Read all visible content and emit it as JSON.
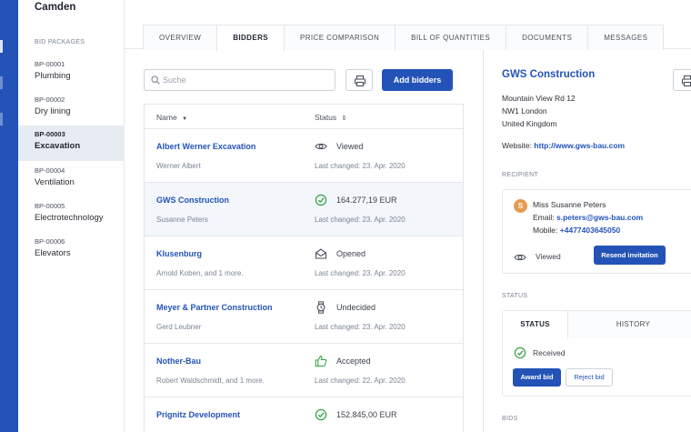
{
  "project": {
    "title": "Camden"
  },
  "sidebar": {
    "section_label": "BID PACKAGES",
    "packages": [
      {
        "code": "BP-00001",
        "name": "Plumbing"
      },
      {
        "code": "BP-00002",
        "name": "Dry lining"
      },
      {
        "code": "BP-00003",
        "name": "Excavation"
      },
      {
        "code": "BP-00004",
        "name": "Ventilation"
      },
      {
        "code": "BP-00005",
        "name": "Electrotechnology"
      },
      {
        "code": "BP-00006",
        "name": "Elevators"
      }
    ]
  },
  "tabs": [
    "OVERVIEW",
    "BIDDERS",
    "PRICE COMPARISON",
    "BILL OF QUANTITIES",
    "DOCUMENTS",
    "MESSAGES"
  ],
  "toolbar": {
    "search_placeholder": "Suche",
    "add_label": "Add bidders"
  },
  "table": {
    "col_name": "Name",
    "col_status": "Status",
    "rows": [
      {
        "name": "Albert Werner Excavation",
        "contact": "Werner Albert",
        "status": "Viewed",
        "status_icon": "eye-icon",
        "changed": "Last changed: 23. Apr. 2020"
      },
      {
        "name": "GWS Construction",
        "contact": "Susanne Peters",
        "status": "164.277,19 EUR",
        "status_icon": "check-circle-icon",
        "changed": "Last changed: 23. Apr. 2020"
      },
      {
        "name": "Klusenburg",
        "contact": "Arnold Koben, and 1 more.",
        "status": "Opened",
        "status_icon": "envelope-open-icon",
        "changed": "Last changed: 23. Apr. 2020"
      },
      {
        "name": "Meyer & Partner Construction",
        "contact": "Gerd Leubner",
        "status": "Undecided",
        "status_icon": "watch-icon",
        "changed": "Last changed: 23. Apr. 2020"
      },
      {
        "name": "Nother-Bau",
        "contact": "Robert Waldschmidt, and 1 more.",
        "status": "Accepted",
        "status_icon": "thumbs-up-icon",
        "changed": "Last changed: 22. Apr. 2020"
      },
      {
        "name": "Prignitz Development",
        "contact": "",
        "status": "152.845,00 EUR",
        "status_icon": "check-circle-icon",
        "changed": ""
      }
    ]
  },
  "detail": {
    "company": "GWS Construction",
    "address": [
      "Mountain View Rd 12",
      "NW1 London",
      "United Kingdom"
    ],
    "website_label": "Website:",
    "website": "http://www.gws-bau.com",
    "recipient_label": "RECIPIENT",
    "recipient": {
      "initial": "S",
      "name": "Miss Susanne Peters",
      "email_label": "Email:",
      "email": "s.peters@gws-bau.com",
      "mobile_label": "Mobile:",
      "mobile": "+4477403645050",
      "state": "Viewed",
      "resend_label": "Resend invitation"
    },
    "status_label": "STATUS",
    "status_tabs": [
      "STATUS",
      "HISTORY"
    ],
    "status_value": "Received",
    "award_label": "Award bid",
    "reject_label": "Reject bid",
    "bids_label": "BIDS"
  },
  "colors": {
    "accent": "#2453b8",
    "success": "#3aa64a",
    "avatar": "#e59b52"
  }
}
